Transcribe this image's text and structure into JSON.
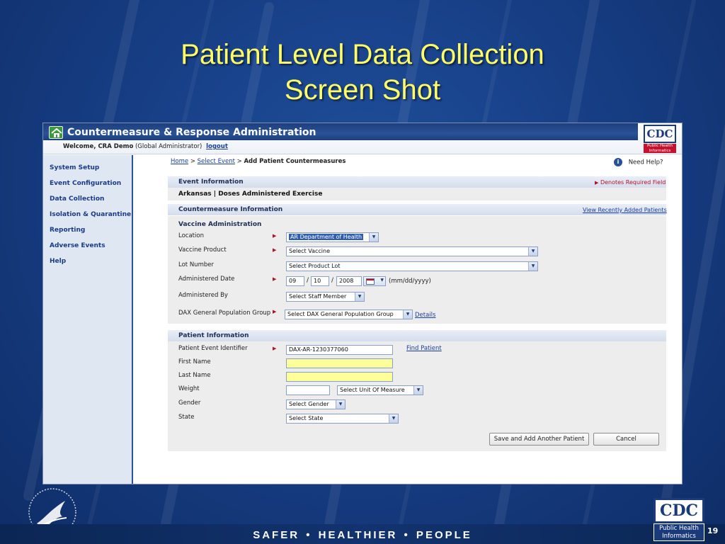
{
  "slide": {
    "title_line1": "Patient Level Data Collection",
    "title_line2": "Screen Shot",
    "tagline": "SAFER • HEALTHIER • PEOPLE",
    "page_number": "19",
    "cdc_logo": "CDC",
    "cdc_sub_line1": "Public Health",
    "cdc_sub_line2": "Informatics"
  },
  "app": {
    "title": "Countermeasure & Response Administration",
    "welcome_label": "Welcome, CRA Demo",
    "role": "(Global Administrator)",
    "logout": "logout",
    "cdc_logo": "CDC",
    "cdc_sub_line1": "Public Health",
    "cdc_sub_line2": "Informatics"
  },
  "sidebar": {
    "items": [
      {
        "label": "System Setup"
      },
      {
        "label": "Event Configuration"
      },
      {
        "label": "Data Collection"
      },
      {
        "label": "Isolation & Quarantine"
      },
      {
        "label": "Reporting"
      },
      {
        "label": "Adverse Events"
      },
      {
        "label": "Help"
      }
    ]
  },
  "breadcrumb": {
    "home": "Home",
    "sep1": ">",
    "select_event": "Select Event",
    "sep2": ">",
    "current": "Add Patient Countermeasures"
  },
  "help": {
    "label": "Need Help?",
    "icon": "info-icon",
    "glyph": "i"
  },
  "event_info": {
    "heading": "Event Information",
    "required_note": "Denotes Required Field",
    "event_name": "Arkansas | Doses Administered Exercise"
  },
  "countermeasure": {
    "heading": "Countermeasure Information",
    "recent_link": "View Recently Added Patients",
    "sub_heading": "Vaccine Administration",
    "location_label": "Location",
    "location_value": "AR Department of Health",
    "vaccine_label": "Vaccine Product",
    "vaccine_value": "Select Vaccine",
    "lot_label": "Lot Number",
    "lot_value": "Select Product Lot",
    "date_label": "Administered Date",
    "date_month": "09",
    "date_day": "10",
    "date_year": "2008",
    "date_sep": "/",
    "date_hint": "(mm/dd/yyyy)",
    "by_label": "Administered By",
    "by_value": "Select Staff Member",
    "dax_label": "DAX General Population Group",
    "dax_value": "Select DAX General Population Group",
    "details_link": "Details"
  },
  "patient": {
    "heading": "Patient Information",
    "identifier_label": "Patient Event Identifier",
    "identifier_value": "DAX-AR-1230377060",
    "find_link": "Find Patient",
    "first_name_label": "First Name",
    "first_name_value": "",
    "last_name_label": "Last Name",
    "last_name_value": "",
    "weight_label": "Weight",
    "weight_value": "",
    "unit_value": "Select Unit Of Measure",
    "gender_label": "Gender",
    "gender_value": "Select Gender",
    "state_label": "State",
    "state_value": "Select State"
  },
  "buttons": {
    "save_add": "Save and Add Another Patient",
    "cancel": "Cancel"
  },
  "colors": {
    "title_yellow": "#ffff66",
    "required_red": "#b0102a",
    "link_blue": "#1a3fa0",
    "required_field_yellow": "#ffff99"
  }
}
